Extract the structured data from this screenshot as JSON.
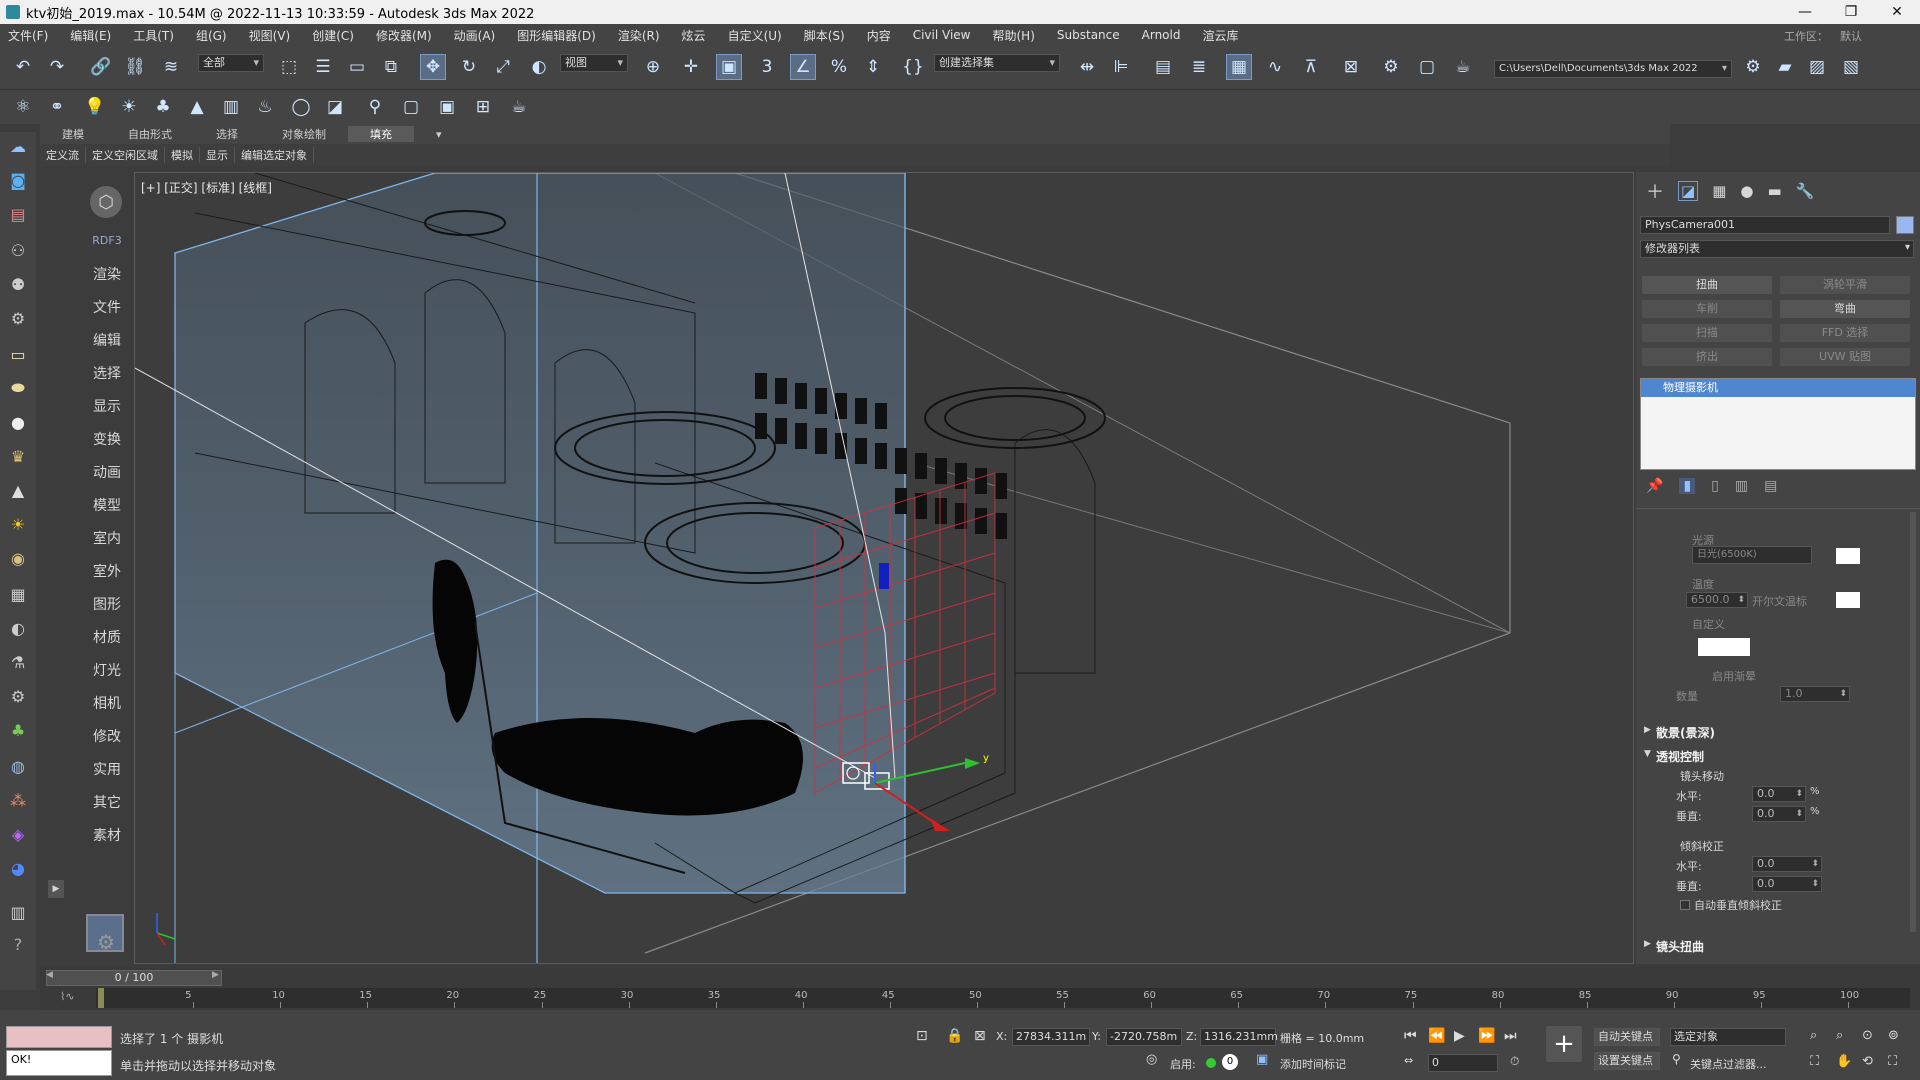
{
  "window": {
    "title": "ktv初始_2019.max - 10.54M @ 2022-11-13 10:33:59 - Autodesk 3ds Max 2022",
    "minimize": "—",
    "maximize": "❐",
    "close": "✕"
  },
  "menu": [
    "文件(F)",
    "编辑(E)",
    "工具(T)",
    "组(G)",
    "视图(V)",
    "创建(C)",
    "修改器(M)",
    "动画(A)",
    "图形编辑器(D)",
    "渲染(R)",
    "炫云",
    "自定义(U)",
    "脚本(S)",
    "内容",
    "Civil View",
    "帮助(H)",
    "Substance",
    "Arnold",
    "渲云库"
  ],
  "workspace": {
    "label": "工作区：",
    "value": "默认"
  },
  "toolbar": {
    "selection_filter": "全部",
    "ref_coord": "视图",
    "named_selection": "创建选择集",
    "project_path": "C:\\Users\\Dell\\Documents\\3ds Max 2022"
  },
  "ribbon": {
    "tabs": [
      "建模",
      "自由形式",
      "选择",
      "对象绘制",
      "填充"
    ],
    "selected": "填充"
  },
  "subribbon": [
    "定义流",
    "定义空闲区域",
    "模拟",
    "显示",
    "编辑选定对象"
  ],
  "command_column": {
    "rdf": "RDF3",
    "items": [
      "渲染",
      "文件",
      "编辑",
      "选择",
      "显示",
      "变换",
      "动画",
      "模型",
      "室内",
      "室外",
      "图形",
      "材质",
      "灯光",
      "相机",
      "修改",
      "实用",
      "其它",
      "素材"
    ]
  },
  "viewport": {
    "label": "[+] [正交] [标准] [线框]"
  },
  "modify_panel": {
    "object_name": "PhysCamera001",
    "object_color": "#9bb6ee",
    "modifier_list": "修改器列表",
    "buttons": [
      {
        "label": "扭曲",
        "enabled": true
      },
      {
        "label": "涡轮平滑",
        "enabled": false
      },
      {
        "label": "车削",
        "enabled": false
      },
      {
        "label": "弯曲",
        "enabled": true
      },
      {
        "label": "扫描",
        "enabled": false
      },
      {
        "label": "FFD 选择",
        "enabled": false
      },
      {
        "label": "挤出",
        "enabled": false
      },
      {
        "label": "UVW 贴图",
        "enabled": false
      }
    ],
    "stack_item": "物理摄影机",
    "light_section": {
      "illuminant_label": "光源",
      "illuminant_value": "日光(6500K)",
      "temperature_label": "温度",
      "temperature_value": "6500.0",
      "kelvin_label": "开尔文温标",
      "custom_label": "自定义",
      "vignette_label": "启用渐晕",
      "amount_label": "数量",
      "amount_value": "1.0"
    },
    "bokeh_section": "散景(景深)",
    "perspective_section": "透视控制",
    "lens_shift_label": "镜头移动",
    "horizontal_label": "水平:",
    "vertical_label": "垂直:",
    "shift_h": "0.0",
    "shift_v": "0.0",
    "percent": "%",
    "tilt_label": "倾斜校正",
    "tilt_h": "0.0",
    "tilt_v": "0.0",
    "auto_tilt_label": "自动垂直倾斜校正",
    "distortion_section": "镜头扭曲"
  },
  "timeline": {
    "frame": "0 / 100",
    "ticks": [
      "5",
      "10",
      "15",
      "20",
      "25",
      "30",
      "35",
      "40",
      "45",
      "50",
      "55",
      "60",
      "65",
      "70",
      "75",
      "80",
      "85",
      "90",
      "95",
      "100"
    ]
  },
  "status": {
    "selection": "选择了 1 个 摄影机",
    "prompt": "单击并拖动以选择并移动对象",
    "script_out": "OK!",
    "x_label": "X:",
    "x": "27834.311m",
    "y_label": "Y:",
    "y": "-2720.758m",
    "z_label": "Z:",
    "z": "1316.231mm",
    "grid": "栅格 = 10.0mm",
    "enable": "启用:",
    "add_time_tag": "添加时间标记",
    "auto_key": "自动关键点",
    "set_key": "设置关键点",
    "selected_object": "选定对象",
    "key_filter": "关键点过滤器...",
    "frame_field": "0"
  }
}
